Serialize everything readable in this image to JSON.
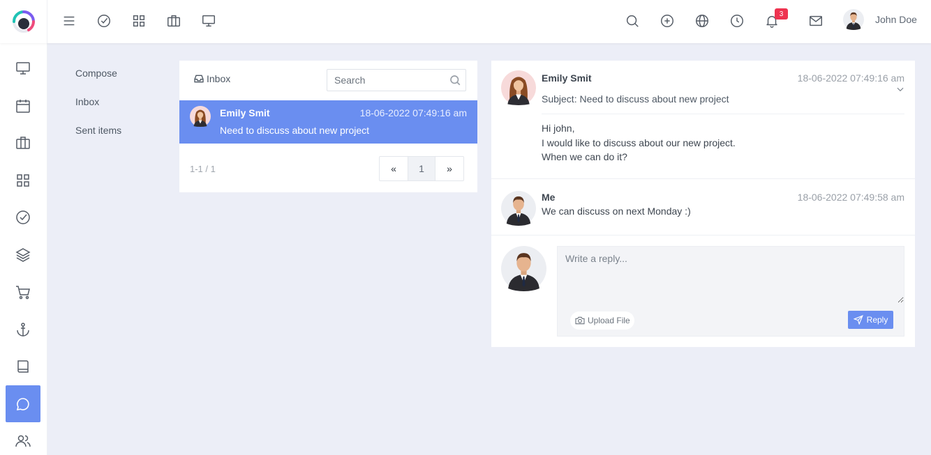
{
  "topbar": {
    "user_name": "John Doe",
    "notification_count": "3",
    "left_icons": [
      "menu-icon",
      "check-circle-icon",
      "grid-icon",
      "briefcase-icon",
      "monitor-icon"
    ],
    "right_icons": [
      "search-icon",
      "plus-circle-icon",
      "globe-icon",
      "clock-icon",
      "bell-icon",
      "mail-icon"
    ]
  },
  "sidebar": {
    "items": [
      "monitor-icon",
      "calendar-icon",
      "briefcase-icon",
      "grid-icon",
      "check-circle-icon",
      "layers-icon",
      "cart-icon",
      "anchor-icon",
      "book-icon",
      "chat-icon",
      "users-icon"
    ],
    "active": "chat-icon"
  },
  "mailnav": {
    "compose": "Compose",
    "inbox": "Inbox",
    "sent": "Sent items"
  },
  "inbox": {
    "title": "Inbox",
    "search_placeholder": "Search",
    "rows": [
      {
        "from": "Emily Smit",
        "date": "18-06-2022 07:49:16 am",
        "subject": "Need to discuss about new project"
      }
    ],
    "pager_text": "1-1 / 1",
    "pager": {
      "prev": "«",
      "current": "1",
      "next": "»"
    }
  },
  "thread": {
    "message1": {
      "from": "Emily Smit",
      "date": "18-06-2022 07:49:16 am",
      "subject": "Subject: Need to discuss about new project",
      "body_lines": [
        "Hi john,",
        "I would like to discuss about our new project.",
        "When we can do it?"
      ]
    },
    "message2": {
      "from": "Me",
      "date": "18-06-2022 07:49:58 am",
      "text": "We can discuss on next Monday :)"
    },
    "reply": {
      "placeholder": "Write a reply...",
      "upload_label": "Upload File",
      "reply_label": "Reply"
    }
  },
  "colors": {
    "accent": "#6a8ef0",
    "background": "#eceef7",
    "badge": "#ee3350"
  }
}
